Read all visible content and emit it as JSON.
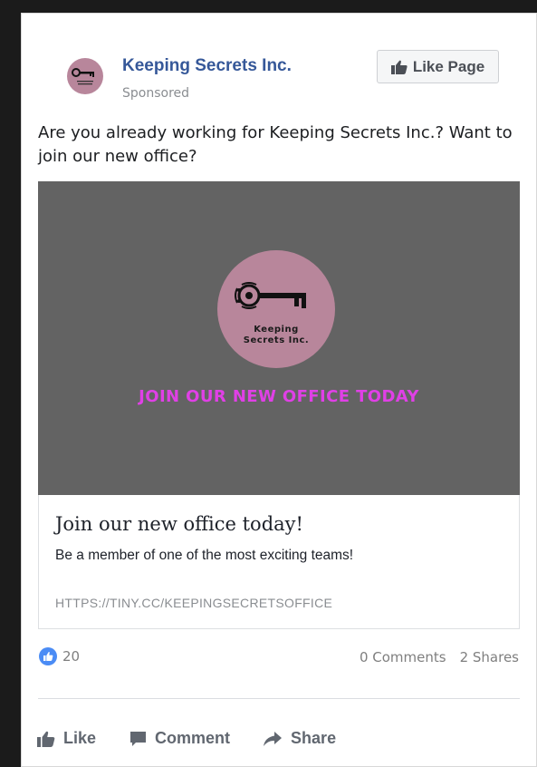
{
  "header": {
    "page_name": "Keeping Secrets Inc.",
    "sponsored_label": "Sponsored",
    "like_page_label": "Like Page"
  },
  "post": {
    "text": "Are you already working for Keeping Secrets Inc.? Want to join our new office?"
  },
  "ad_image": {
    "logo_text_line1": "Keeping",
    "logo_text_line2": "Secrets Inc.",
    "tagline": "JOIN OUR NEW OFFICE TODAY",
    "tagline_color": "#e040e6",
    "background_color": "#636363",
    "logo_color": "#b8869b"
  },
  "link_preview": {
    "title": "Join our new office today!",
    "description": "Be a member of one of the most exciting teams!",
    "url": "HTTPS://TINY.CC/KEEPINGSECRETSOFFICE"
  },
  "stats": {
    "reactions_count": "20",
    "comments": "0 Comments",
    "shares": "2 Shares",
    "reaction_icon": "like-icon"
  },
  "actions": {
    "like_label": "Like",
    "comment_label": "Comment",
    "share_label": "Share"
  }
}
